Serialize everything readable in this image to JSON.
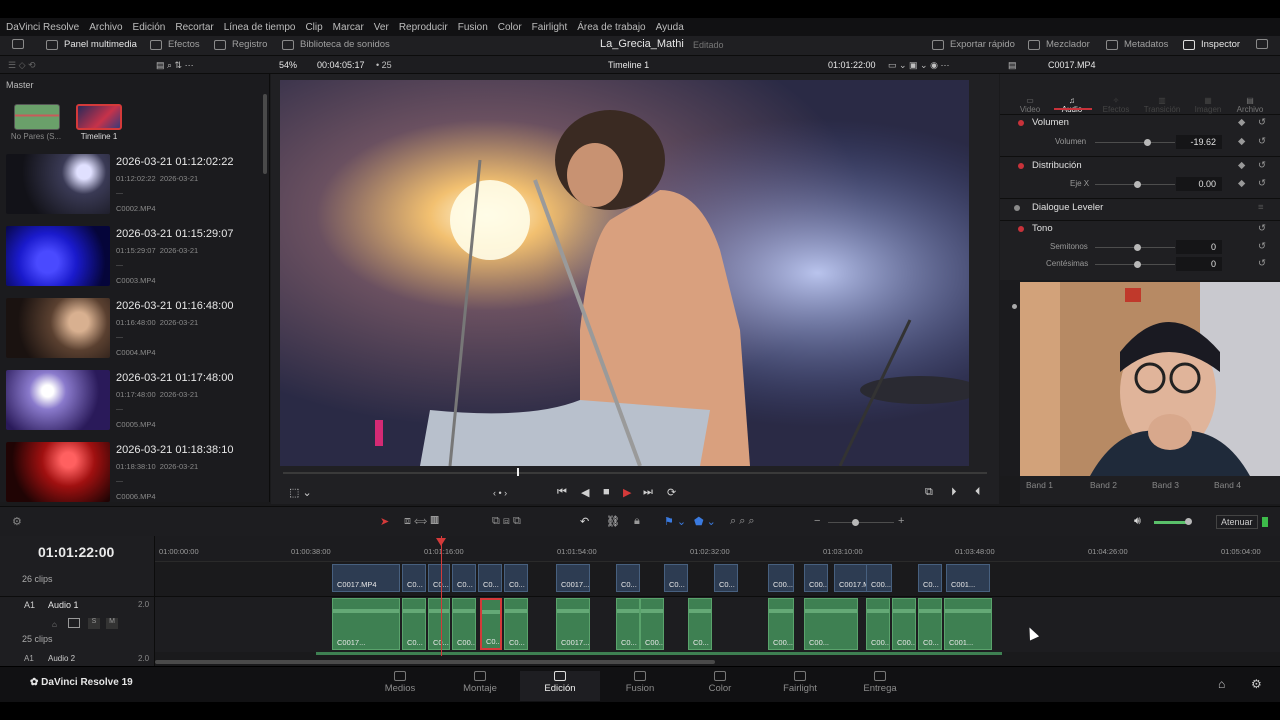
{
  "menu": [
    "DaVinci Resolve",
    "Archivo",
    "Edición",
    "Recortar",
    "Línea de tiempo",
    "Clip",
    "Marcar",
    "Ver",
    "Reproducir",
    "Fusion",
    "Color",
    "Fairlight",
    "Área de trabajo",
    "Ayuda"
  ],
  "toolbar": {
    "media_pool": "Panel multimedia",
    "effects": "Efectos",
    "index": "Registro",
    "sound_library": "Biblioteca de sonidos",
    "project_title": "La_Grecia_Mathi",
    "project_status": "Editado",
    "quick_export": "Exportar rápido",
    "mixer": "Mezclador",
    "metadata": "Metadatos",
    "inspector": "Inspector"
  },
  "viewer_bar": {
    "zoom": "54%",
    "source_tc": "00:04:05:17",
    "fps": "25",
    "timeline_name": "Timeline 1",
    "record_tc": "01:01:22:00",
    "clip_name": "C0017.MP4"
  },
  "media_pool": {
    "master": "Master",
    "bins": [
      {
        "label": "No Pares (S...",
        "color": "#6aa06a"
      },
      {
        "label": "Timeline 1",
        "color": "#c7324a"
      }
    ],
    "clips": [
      {
        "title": "2026-03-21  01:12:02:22",
        "tc": "01:12:02:22",
        "date": "2026-03-21",
        "dash": "—",
        "file": "C0002.MP4"
      },
      {
        "title": "2026-03-21  01:15:29:07",
        "tc": "01:15:29:07",
        "date": "2026-03-21",
        "dash": "—",
        "file": "C0003.MP4"
      },
      {
        "title": "2026-03-21  01:16:48:00",
        "tc": "01:16:48:00",
        "date": "2026-03-21",
        "dash": "—",
        "file": "C0004.MP4"
      },
      {
        "title": "2026-03-21  01:17:48:00",
        "tc": "01:17:48:00",
        "date": "2026-03-21",
        "dash": "—",
        "file": "C0005.MP4"
      },
      {
        "title": "2026-03-21  01:18:38:10",
        "tc": "01:18:38:10",
        "date": "2026-03-21",
        "dash": "—",
        "file": "C0006.MP4"
      }
    ]
  },
  "inspector": {
    "tabs": [
      "Video",
      "Audio",
      "Efectos",
      "Transición",
      "Imagen",
      "Archivo"
    ],
    "active_tab": "Audio",
    "volume_section": "Volumen",
    "volume_label": "Volumen",
    "volume_value": "-19.62",
    "pan_section": "Distribución",
    "pan_label": "Eje X",
    "pan_value": "0.00",
    "dialogue_leveler": "Dialogue Leveler",
    "pitch_section": "Tono",
    "semitones_label": "Semitonos",
    "semitones_value": "0",
    "cents_label": "Centésimas",
    "cents_value": "0",
    "bands": [
      "Band 1",
      "Band 2",
      "Band 3",
      "Band 4"
    ]
  },
  "timeline": {
    "current_tc": "01:01:22:00",
    "ruler": [
      "01:00:00:00",
      "01:00:38:00",
      "01:01:16:00",
      "01:01:54:00",
      "01:02:32:00",
      "01:03:10:00",
      "01:03:48:00",
      "01:04:26:00",
      "01:05:04:00"
    ],
    "video_track_count": "26 clips",
    "audio_track_id": "A1",
    "audio_track_name": "Audio 1",
    "audio_track_level": "2.0",
    "audio_track_count": "25 clips",
    "audio2_id": "A1",
    "audio2_name": "Audio 2",
    "audio2_level": "2.0",
    "solo": "S",
    "mute": "M",
    "attenuate": "Atenuar",
    "video_clips": [
      "C0017.MP4",
      "C0...",
      "C0...",
      "C0...",
      "C0...",
      "C0...",
      "C0017...",
      "C0...",
      "C0...",
      "C0...",
      "C00...",
      "C00...",
      "C0017.M...",
      "C00...",
      "C0...",
      "C001..."
    ],
    "audio_clips": [
      "C0017...",
      "C0...",
      "C0...",
      "C00...",
      "C0...",
      "C0...",
      "C0017...",
      "C0...",
      "C00...",
      "C0...",
      "C00...",
      "C00...",
      "C00...",
      "C00...",
      "C0...",
      "C001..."
    ]
  },
  "pages": [
    "Medios",
    "Montaje",
    "Edición",
    "Fusion",
    "Color",
    "Fairlight",
    "Entrega"
  ],
  "active_page": "Edición",
  "brand": "DaVinci Resolve 19",
  "colors": {
    "accent_red": "#d43a3a",
    "audio_clip": "#3e8052",
    "video_clip": "#2d3c52"
  }
}
